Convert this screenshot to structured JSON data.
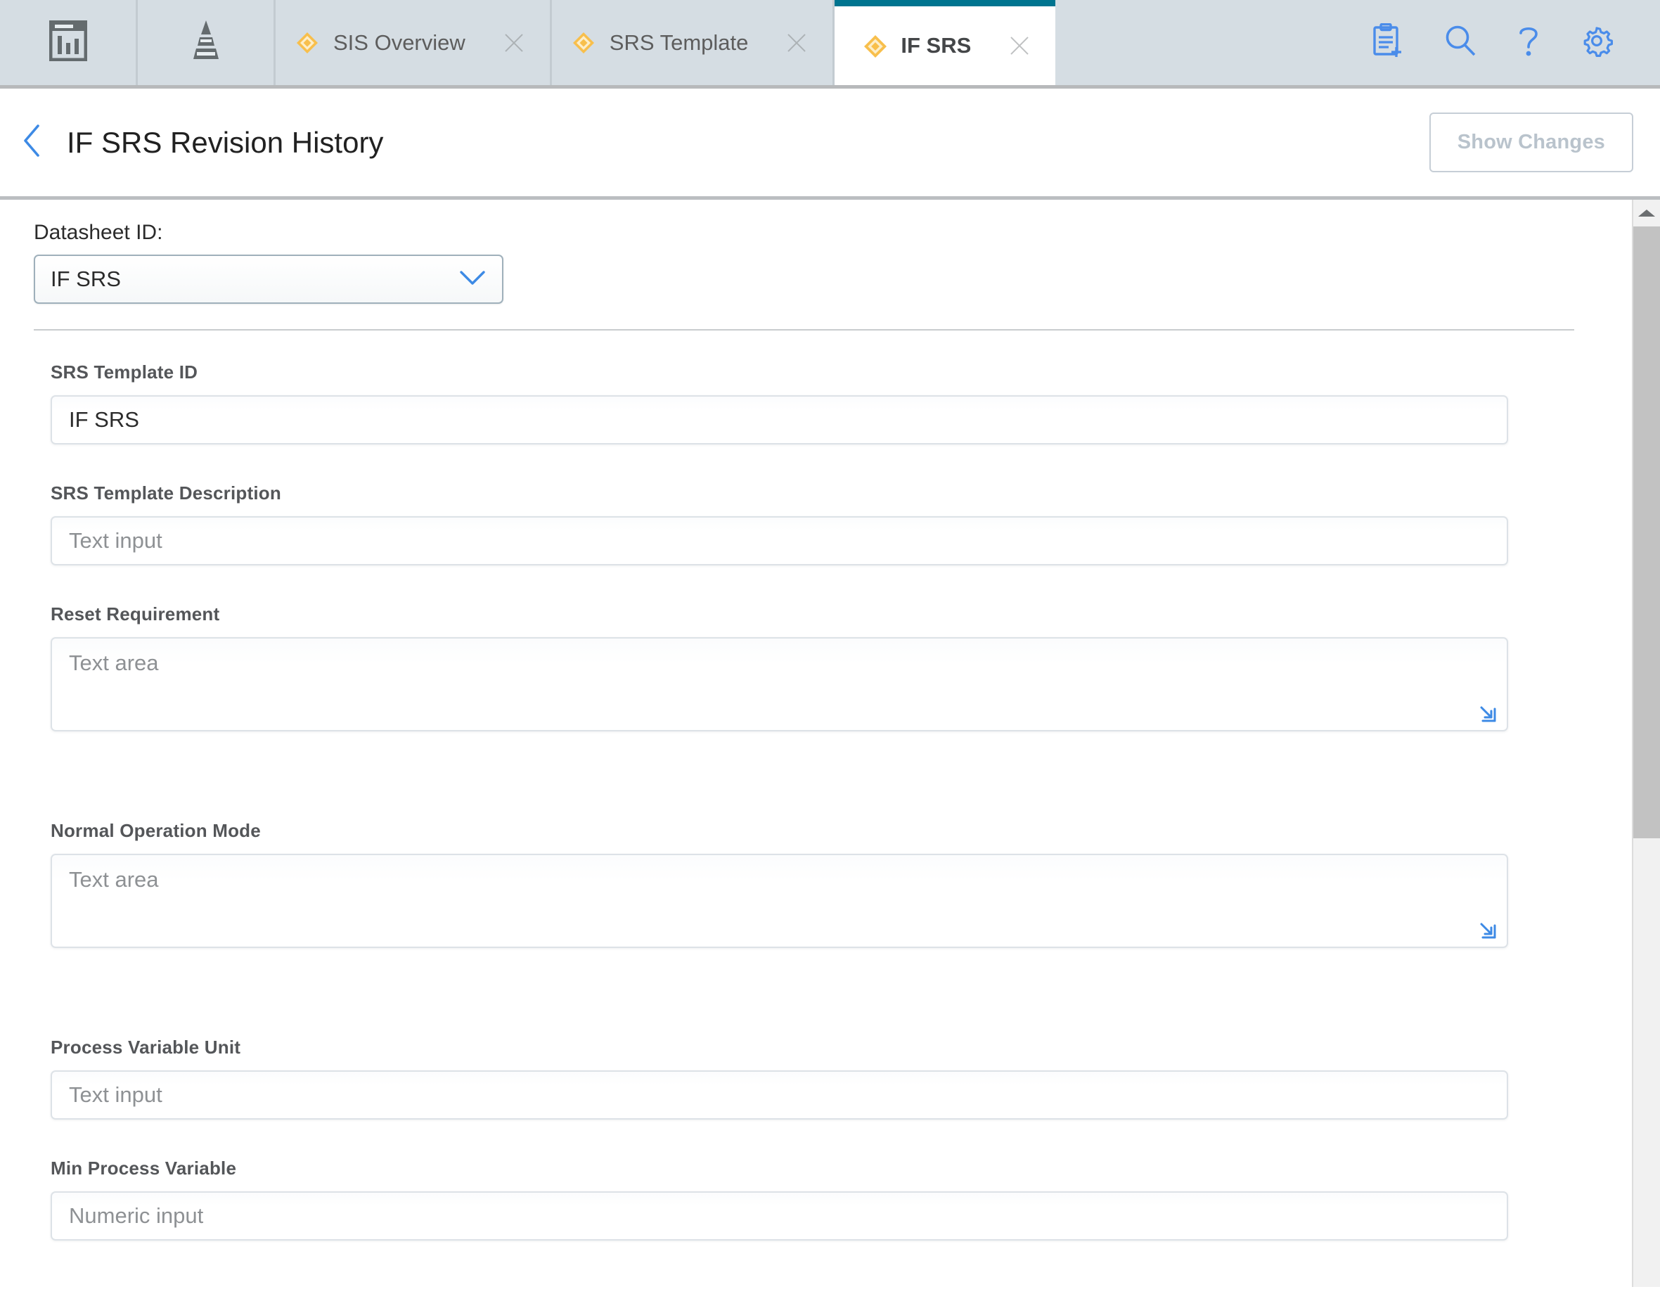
{
  "tabbar": {
    "nav_buttons": [
      {
        "name": "dashboard-icon",
        "label": "Dashboard"
      },
      {
        "name": "hierarchy-icon",
        "label": "Hierarchy"
      }
    ],
    "tabs": [
      {
        "label": "SIS Overview",
        "icon": "diamond-icon",
        "active": false,
        "closable": true
      },
      {
        "label": "SRS Template",
        "icon": "diamond-icon",
        "active": false,
        "closable": true
      },
      {
        "label": "IF SRS",
        "icon": "diamond-icon",
        "active": true,
        "closable": true
      }
    ],
    "toolbar_icons": [
      {
        "name": "new-record-icon",
        "label": "New Record"
      },
      {
        "name": "search-icon",
        "label": "Search"
      },
      {
        "name": "help-icon",
        "label": "Help"
      },
      {
        "name": "gear-icon",
        "label": "Settings"
      }
    ],
    "accent_active_tab": "#00748f",
    "tab_icon_color": "#f5b942",
    "toolbar_icon_color": "#4a8cea",
    "background": "#d5dde3"
  },
  "header": {
    "back_label": "Back",
    "title": "IF SRS Revision History",
    "show_changes_label": "Show Changes"
  },
  "datasheet": {
    "label": "Datasheet ID:",
    "value": "IF SRS",
    "chevron": "chevron-down-icon"
  },
  "fields": [
    {
      "label": "SRS Template ID",
      "type": "input",
      "value": "IF SRS",
      "placeholder": ""
    },
    {
      "label": "SRS Template Description",
      "type": "input",
      "value": "",
      "placeholder": "Text input"
    },
    {
      "label": "Reset Requirement",
      "type": "textarea",
      "value": "",
      "placeholder": "Text area"
    },
    {
      "label": "Normal Operation Mode",
      "type": "textarea",
      "value": "",
      "placeholder": "Text area"
    },
    {
      "label": "Process Variable Unit",
      "type": "input",
      "value": "",
      "placeholder": "Text input"
    },
    {
      "label": "Min Process Variable",
      "type": "input",
      "value": "",
      "placeholder": "Numeric input"
    }
  ],
  "scrollbar": {
    "up_arrow": "scroll-up-arrow-icon",
    "position_label": "top"
  }
}
